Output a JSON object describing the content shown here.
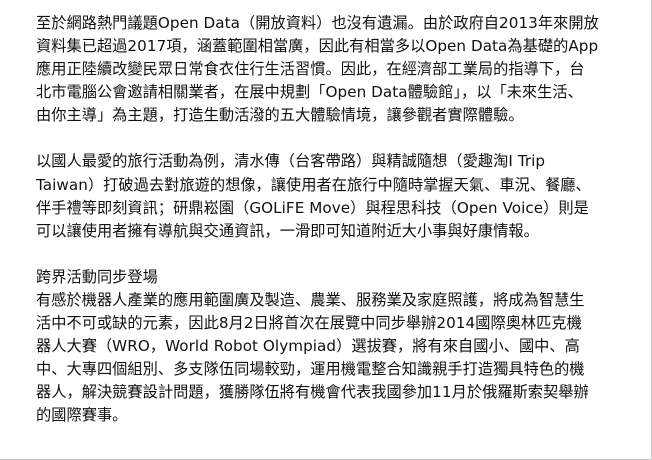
{
  "paragraph_1": {
    "lines": [
      "至於網路熱門議題Open Data（開放資料）也沒有遺漏。由於政府自2013年來開放",
      "資料集已超過2017項，涵蓋範圍相當廣，因此有相當多以Open Data為基礎的App",
      "應用正陸續改變民眾日常食衣住行生活習慣。因此，在經濟部工業局的指導下，台",
      "北市電腦公會邀請相關業者，在展中規劃「Open Data體驗館」，以「未來生活、",
      "由你主導」為主題，打造生動活潑的五大體驗情境，讓參觀者實際體驗。"
    ]
  },
  "paragraph_2": {
    "lines": [
      "以國人最愛的旅行活動為例，清水傳（台客帶路）與精誠隨想（愛趣淘I Trip",
      "Taiwan）打破過去對旅遊的想像，讓使用者在旅行中隨時掌握天氣、車況、餐廳、",
      "伴手禮等即刻資訊；研鼎崧園（GOLiFE Move）與程思科技（Open Voice）則是",
      "可以讓使用者擁有導航與交通資訊，一滑即可知道附近大小事與好康情報。"
    ]
  },
  "section_3": {
    "heading": "跨界活動同步登場",
    "lines": [
      "有感於機器人產業的應用範圍廣及製造、農業、服務業及家庭照護，將成為智慧生",
      "活中不可或缺的元素，因此8月2日將首次在展覽中同步舉辦2014國際奧林匹克機",
      "器人大賽（WRO，World Robot Olympiad）選拔賽，將有來自國小、國中、高",
      "中、大專四個組別、多支隊伍同場較勁，運用機電整合知識親手打造獨具特色的機",
      "器人，解決競賽設計問題，獲勝隊伍將有機會代表我國參加11月於俄羅斯索契舉辦",
      "的國際賽事。"
    ]
  }
}
